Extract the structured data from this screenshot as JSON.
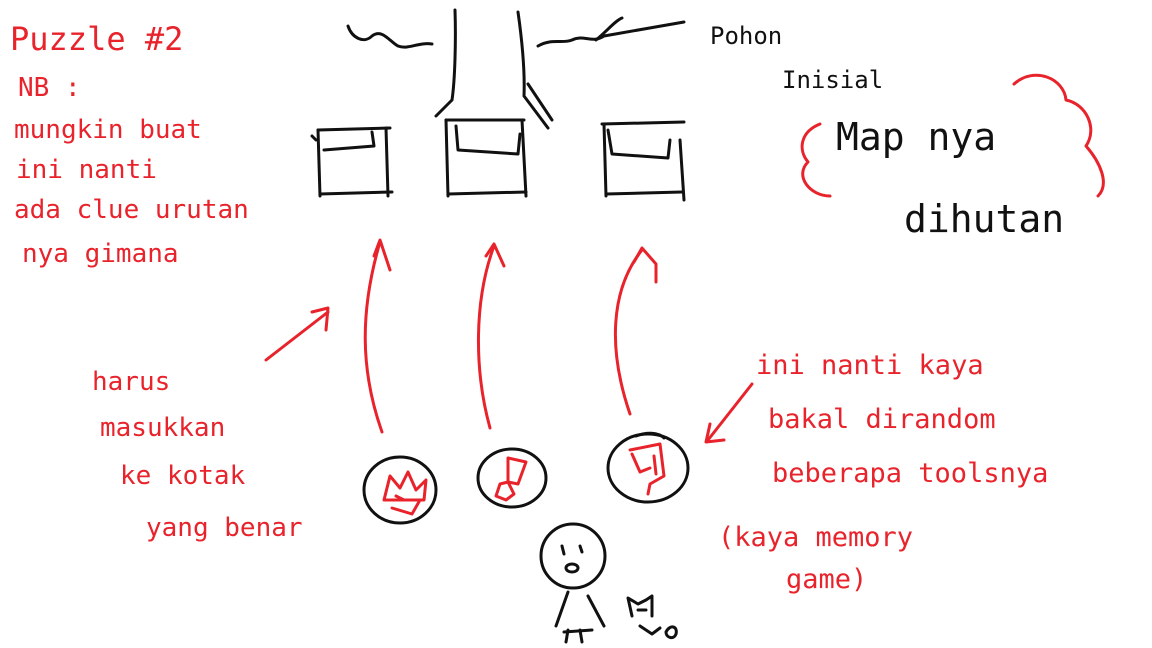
{
  "colors": {
    "ink": "#111111",
    "annotation": "#e8232b",
    "background": "#ffffff"
  },
  "notes": {
    "puzzle_title": "Puzzle #2",
    "nb_lines": [
      "NB :",
      "mungkin buat",
      "ini nanti",
      "ada  clue urutan",
      "nya  gimana"
    ],
    "tree_label_lines": [
      "Pohon",
      "Inisial"
    ],
    "map_cloud_line1": "Map nya",
    "map_cloud_line2": "dihutan",
    "boxes_note_lines": [
      "harus",
      "masukkan",
      "ke kotak",
      "yang benar"
    ],
    "random_note_lines": [
      "ini nanti kaya",
      "bakal dirandom",
      "beberapa toolsnya",
      "(kaya memory",
      "game)"
    ]
  },
  "scene": {
    "tree": "tree-trunk",
    "boxes": [
      "box-left",
      "box-middle",
      "box-right"
    ],
    "items": [
      {
        "name": "item-left",
        "icon": "crown-glyph-icon"
      },
      {
        "name": "item-middle",
        "icon": "tool-glyph-icon"
      },
      {
        "name": "item-right",
        "icon": "flag-glyph-icon"
      }
    ],
    "characters": [
      "player-character",
      "cat-companion"
    ]
  }
}
